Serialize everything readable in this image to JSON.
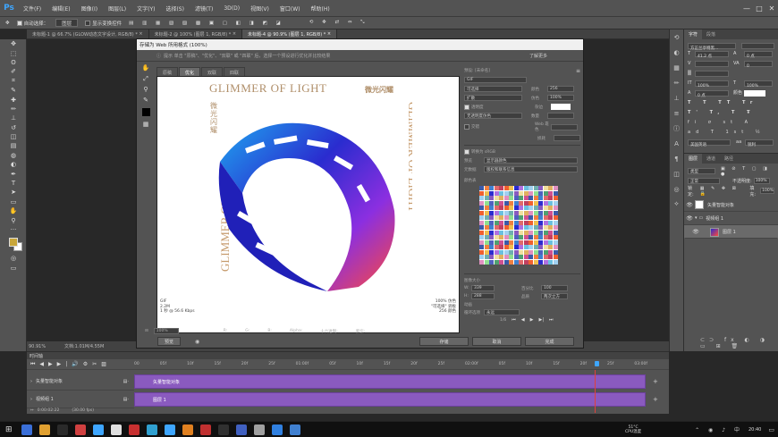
{
  "app": {
    "logo": "Ps"
  },
  "menu": [
    "文件(F)",
    "编辑(E)",
    "图像(I)",
    "图层(L)",
    "文字(Y)",
    "选择(S)",
    "滤镜(T)",
    "3D(D)",
    "视图(V)",
    "窗口(W)",
    "帮助(H)"
  ],
  "window_controls": [
    "—",
    "□",
    "✕"
  ],
  "options": {
    "auto_select": "自动选择：",
    "auto_select_value": "图层",
    "show_transform": "显示变换控件"
  },
  "doc_tabs": [
    {
      "label": "未标题-1 @ 66.7% (GLOW动态文字设计, RGB/8) *"
    },
    {
      "label": "未标题-2 @ 100% (图层 1, RGB/8) *"
    },
    {
      "label": "未标题-4 @ 90.9% (图层 1, RGB/8) *"
    }
  ],
  "status": {
    "zoom": "90.91%",
    "doc": "文档:1.01M/4.55M"
  },
  "dialog": {
    "title": "存储为 Web 所用格式 (100%)",
    "tip": "提示  单击 \"原稿\"、\"优化\"、\"双联\" 或 \"四联\" 后，选择一个预设进行优化并比较结果",
    "learn_more": "了解更多",
    "tabs": [
      "原稿",
      "优化",
      "双联",
      "四联"
    ],
    "preview": {
      "brand_en": "GLIMMER OF LIGHT",
      "brand_cn": "微光闪耀",
      "info_left": [
        "GIF",
        "2.2M",
        "1 秒 @ 56.6 Kbps"
      ],
      "info_right": [
        "100% 仿色",
        "\"可选择\" 调板",
        "256 颜色"
      ]
    },
    "settings": {
      "preset": "预设: [未命名]",
      "format": "GIF",
      "reduction": "可选择",
      "dither_algo": "扩散",
      "transparency": "透明度",
      "matte": "杂边",
      "no_trans_dither": "无透明度仿色",
      "interlaced": "交错",
      "web_snap": "Web 靠色",
      "lossy": "损耗",
      "colors_label": "颜色",
      "colors_value": "256",
      "dither_label": "仿色",
      "dither_value": "100%",
      "amount_label": "数量",
      "convert_srgb": "转换为 sRGB",
      "preview_label": "预览",
      "preview_value": "显示器颜色",
      "metadata_label": "元数据",
      "metadata_value": "版权和联系信息",
      "color_table": "颜色表",
      "image_size": "图像大小",
      "w_label": "W:",
      "w_value": "339",
      "h_label": "H:",
      "h_value": "288",
      "percent_label": "百分比",
      "percent_value": "100",
      "quality_label": "品质",
      "quality_value": "两次立方",
      "animation": "动画",
      "loop_label": "循环选项",
      "loop_value": "永远",
      "frame": "1/6"
    },
    "bottom": {
      "zoom": "100%",
      "r": "R:",
      "g": "G:",
      "b": "B:",
      "alpha": "Alpha:",
      "hex": "十六进制:",
      "index": "索引:",
      "preview_btn": "预览",
      "save_btn": "存储",
      "cancel_btn": "取消",
      "done_btn": "完成"
    }
  },
  "char_panel": {
    "tabs": [
      "字符",
      "段落"
    ],
    "font": "方正兰亭特黑...",
    "size": "41.2 点",
    "leading": "0 点",
    "tracking": "0",
    "scale_v": "100%",
    "scale_h": "100%",
    "baseline": "0 点",
    "lang": "美国英语",
    "aa": "锐利"
  },
  "layers_panel": {
    "tabs": [
      "图层",
      "通道",
      "路径"
    ],
    "kind": "类型",
    "blend": "正常",
    "opacity_label": "不透明度:",
    "opacity": "100%",
    "lock": "锁定:",
    "fill_label": "填充:",
    "fill": "100%",
    "layers": [
      {
        "name": "矢量智能对象"
      },
      {
        "name": "视频组 1"
      },
      {
        "name": "图层 1"
      }
    ]
  },
  "timeline": {
    "title": "时间轴",
    "tracks": [
      "矢量智能对象",
      "视频组 1"
    ],
    "clips": [
      "矢量智能对象",
      "图层 1"
    ],
    "ruler": [
      "00",
      "05f",
      "10f",
      "15f",
      "20f",
      "25f",
      "01:00f",
      "05f",
      "10f",
      "15f",
      "20f",
      "25f",
      "02:00f",
      "05f",
      "10f",
      "15f",
      "20f",
      "25f",
      "03:00f"
    ],
    "time": "0:00:02:22",
    "fps": "(30.00 fps)"
  },
  "taskbar": {
    "temp": "51°C",
    "cpu": "CPU温度",
    "clock": "20:40"
  },
  "colors": {
    "accent": "#8a5abf",
    "playhead": "#e0403a"
  }
}
